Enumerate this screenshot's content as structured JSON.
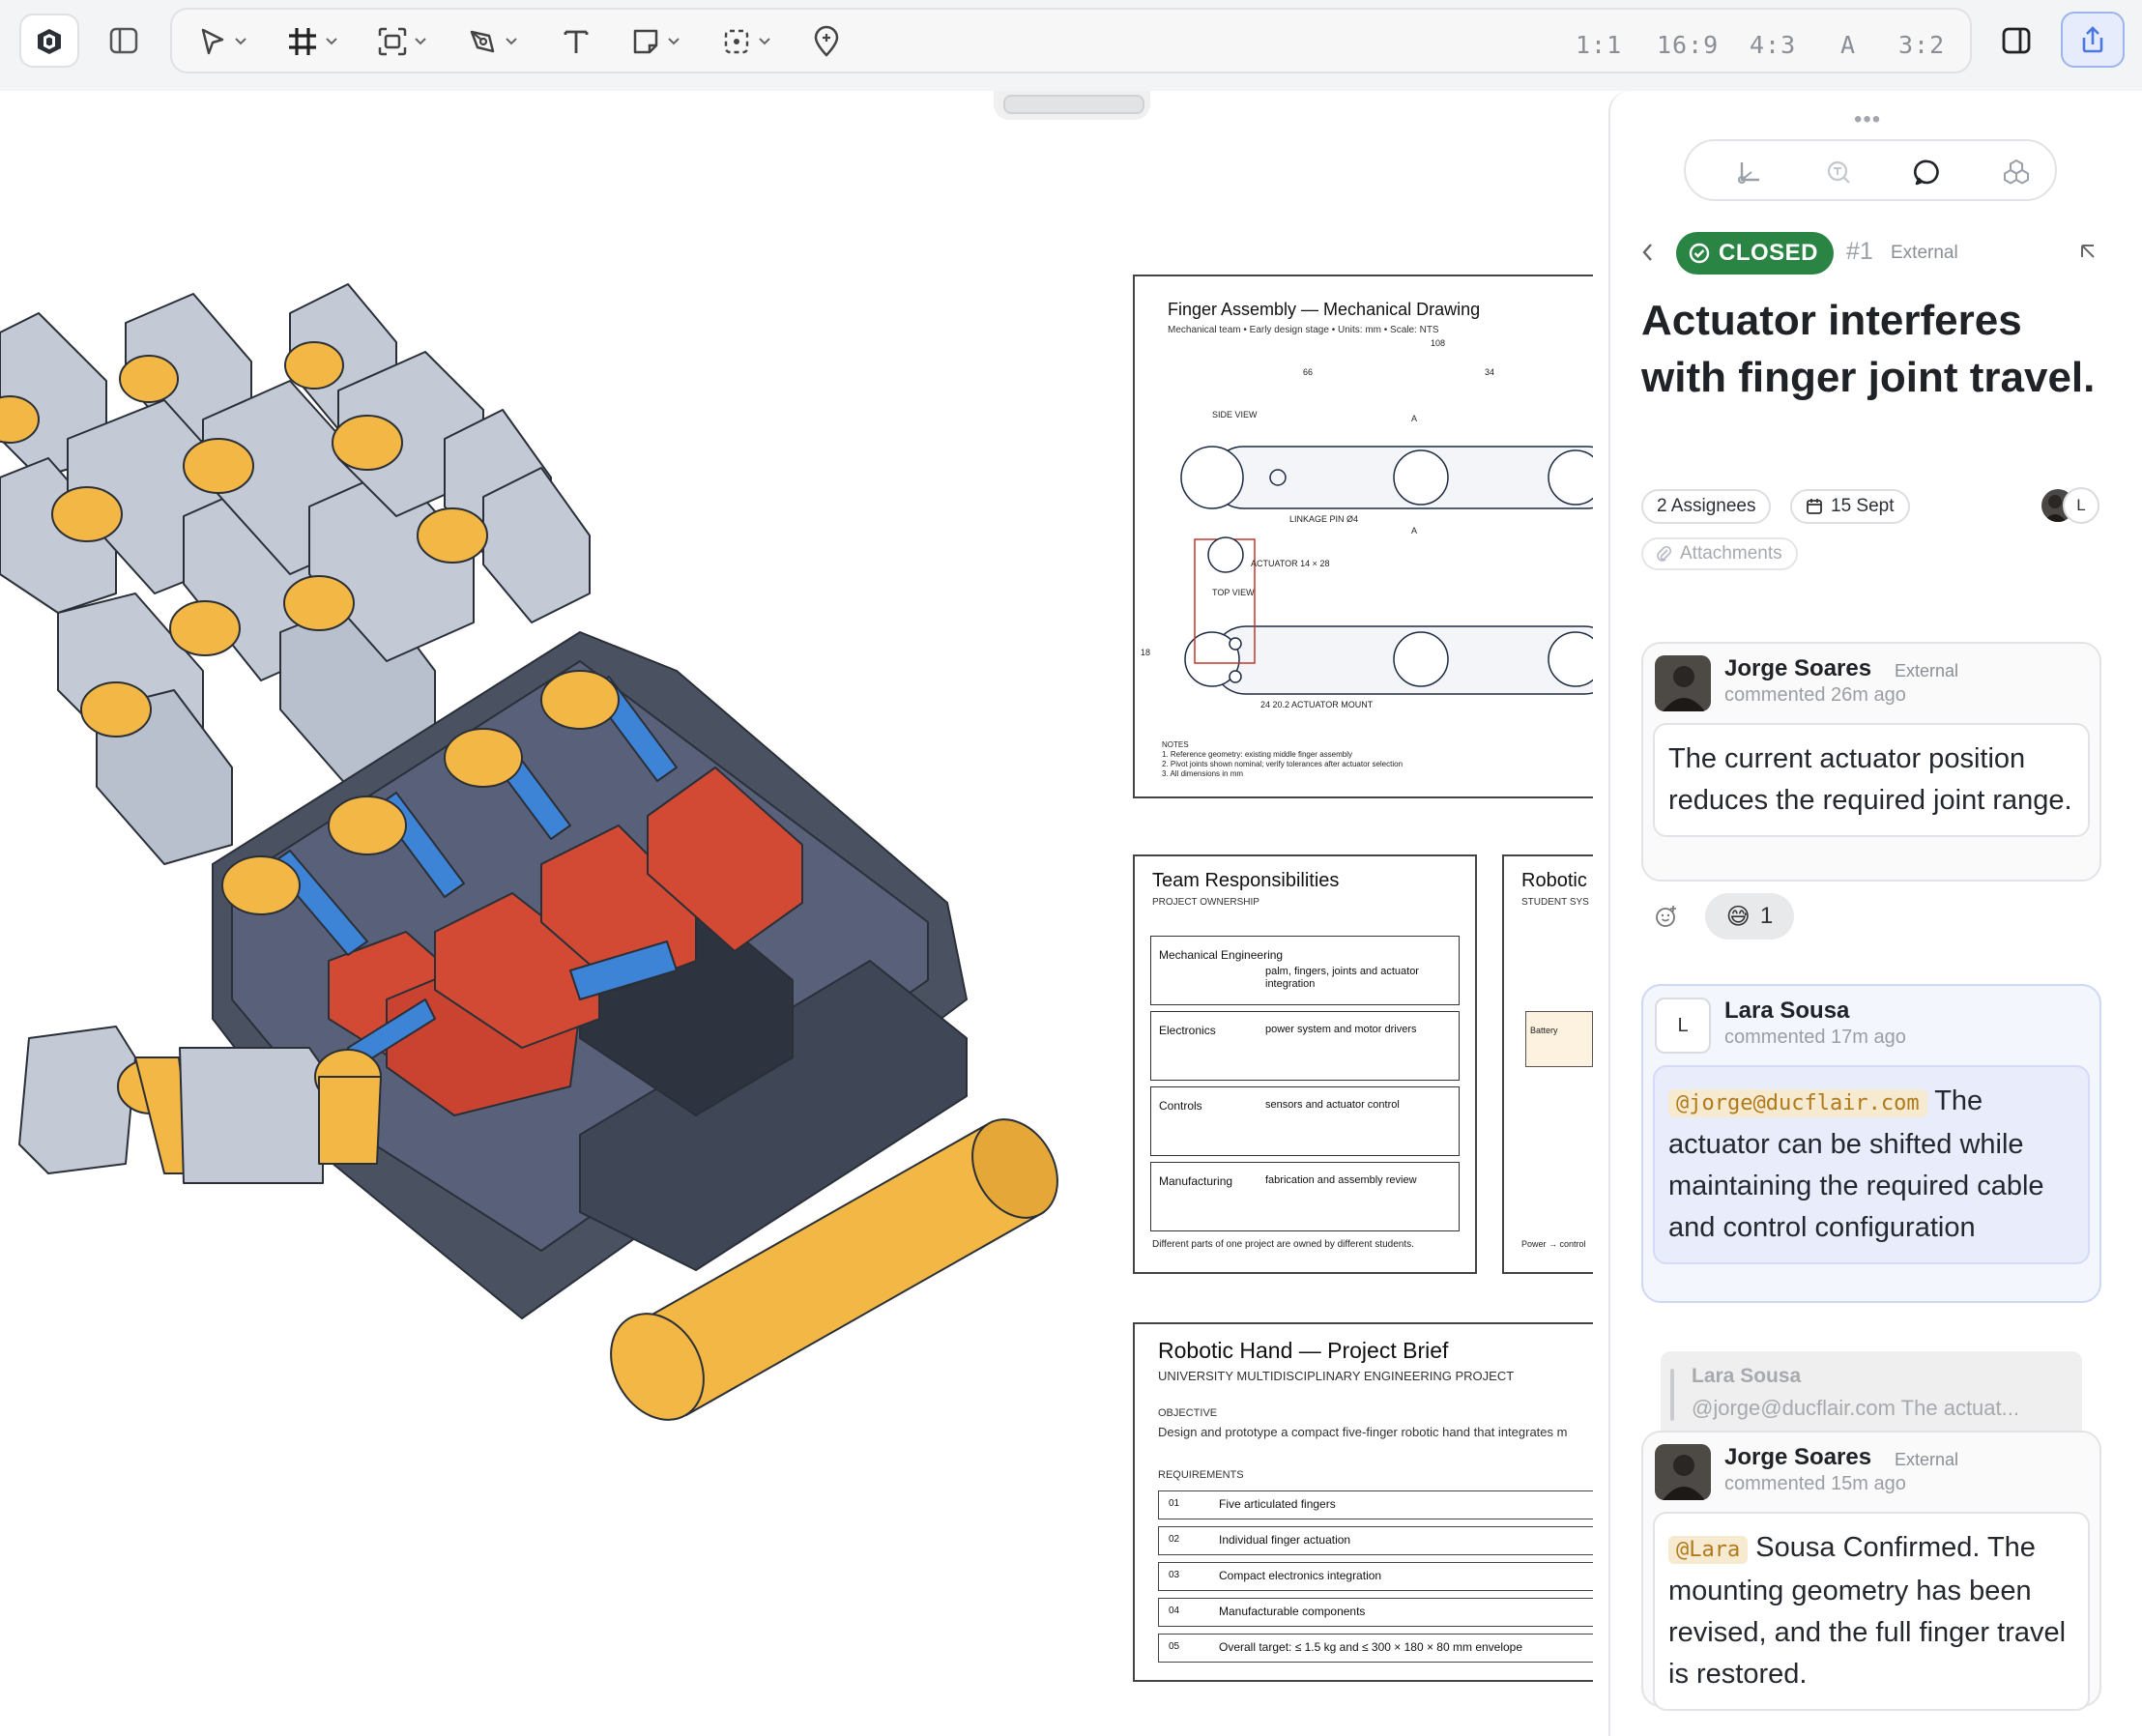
{
  "toolbar": {
    "ratios": [
      "1:1",
      "16:9",
      "4:3",
      "A",
      "3:2"
    ]
  },
  "sheets": {
    "drawing": {
      "title": "Finger Assembly — Mechanical Drawing",
      "subtitle": "Mechanical team • Early design stage • Units: mm • Scale: NTS",
      "dim_top": "108",
      "dim_left": "66",
      "dim_right": "34",
      "side_view": "SIDE VIEW",
      "label_a": "A",
      "linkage_pin": "LINKAGE PIN Ø4",
      "label_a2": "A",
      "actuator": "ACTUATOR 14 × 28",
      "top_view": "TOP VIEW",
      "dim_side": "18",
      "mount": "24 20.2 ACTUATOR MOUNT",
      "notes": [
        "NOTES",
        "1. Reference geometry: existing middle finger assembly",
        "2. Pivot joints shown nominal; verify tolerances after actuator selection",
        "3. All dimensions in mm"
      ]
    },
    "team": {
      "title": "Team Responsibilities",
      "subtitle": "PROJECT OWNERSHIP",
      "rows": [
        {
          "name": "Mechanical Engineering",
          "desc": "palm, fingers, joints and actuator integration"
        },
        {
          "name": "Electronics",
          "desc": "power system and motor drivers"
        },
        {
          "name": "Controls",
          "desc": "sensors and actuator control"
        },
        {
          "name": "Manufacturing",
          "desc": "fabrication and assembly review"
        }
      ],
      "footer": "Different parts of one project are owned by different students."
    },
    "robotic_partial": {
      "title": "Robotic I",
      "subtitle": "STUDENT SYS",
      "battery": "Battery",
      "footer": "Power → control"
    },
    "brief": {
      "title": "Robotic Hand — Project Brief",
      "subtitle": "UNIVERSITY MULTIDISCIPLINARY ENGINEERING PROJECT",
      "objective_label": "OBJECTIVE",
      "objective": "Design and prototype a compact five-finger robotic hand that integrates m",
      "requirements_label": "REQUIREMENTS",
      "requirements": [
        {
          "num": "01",
          "text": "Five articulated fingers"
        },
        {
          "num": "02",
          "text": "Individual finger actuation"
        },
        {
          "num": "03",
          "text": "Compact electronics integration"
        },
        {
          "num": "04",
          "text": "Manufacturable components"
        },
        {
          "num": "05",
          "text": "Overall target: ≤ 1.5 kg and ≤ 300 × 180 × 80 mm envelope"
        }
      ]
    }
  },
  "panel": {
    "status": "CLOSED",
    "issue_number": "#1",
    "visibility": "External",
    "title": "Actuator interferes with finger joint travel.",
    "assignees": "2 Assignees",
    "due_date": "15 Sept",
    "attachments": "Attachments",
    "avatar_letter": "L",
    "comments": [
      {
        "author": "Jorge Soares",
        "tag": "External",
        "time": "commented 26m ago",
        "body": "The current actuator position reduces the required joint range."
      },
      {
        "author": "Lara Sousa",
        "avatar_letter": "L",
        "time": "commented 17m ago",
        "mention": "@jorge@ducflair.com",
        "body": "The actuator can be shifted while maintaining the required cable and control configuration"
      },
      {
        "author": "Jorge Soares",
        "tag": "External",
        "time": "commented 15m ago",
        "mention": "@Lara",
        "body": "Sousa Confirmed. The mounting geometry has been revised, and the full finger travel is restored."
      }
    ],
    "reaction": {
      "emoji": "😅",
      "count": "1"
    },
    "reply_quote": {
      "author": "Lara Sousa",
      "text": "@jorge@ducflair.com The actuat..."
    }
  },
  "colors": {
    "accent": "#4a78e0",
    "closed": "#2a8444",
    "hand_yellow": "#f2b744",
    "hand_grey": "#c3cad6",
    "hand_dark": "#4a5262",
    "hand_red": "#d24a33",
    "hand_blue": "#3e84d6"
  }
}
